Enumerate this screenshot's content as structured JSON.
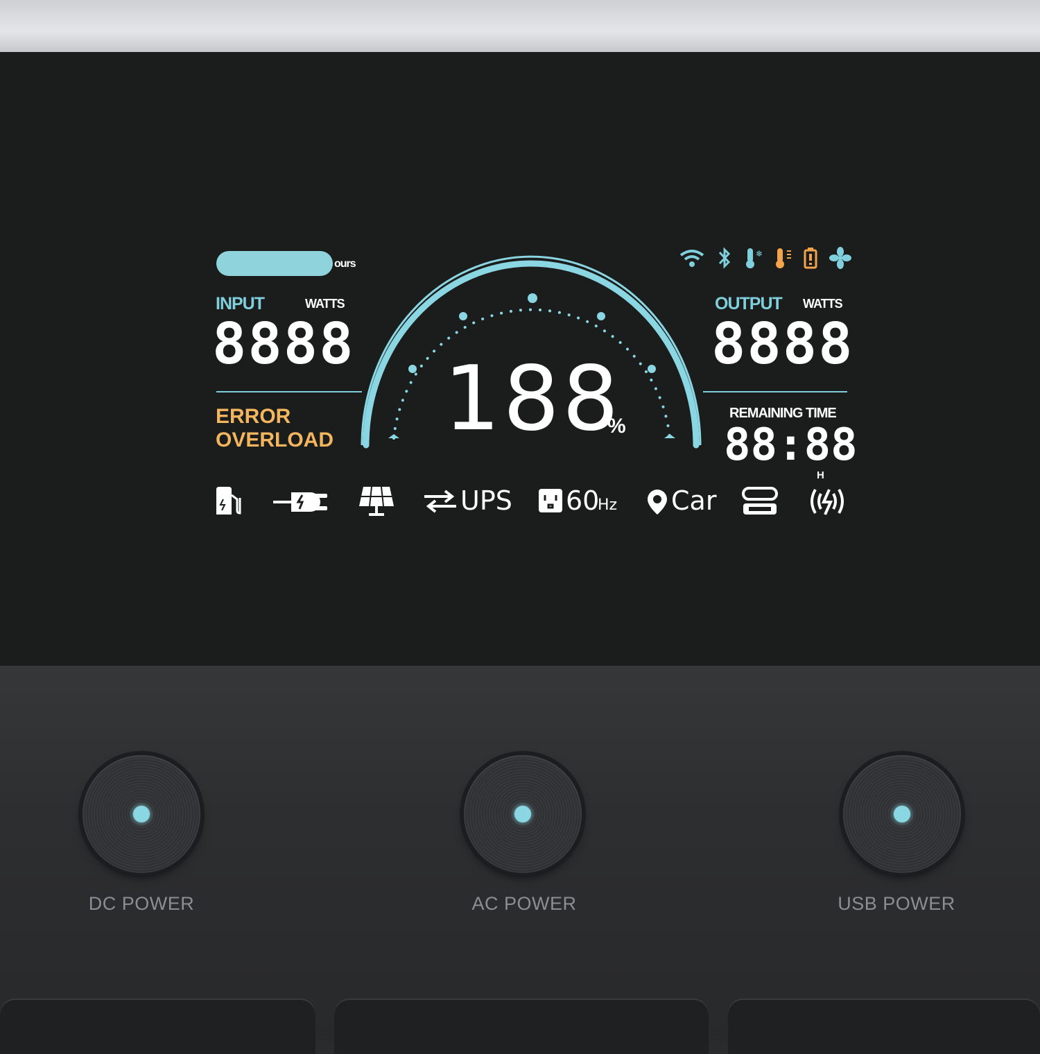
{
  "header": {
    "pill_label": "ours"
  },
  "input": {
    "title": "INPUT",
    "unit": "WATTS",
    "value": "8888"
  },
  "output": {
    "title": "OUTPUT",
    "unit": "WATTS",
    "value": "8888"
  },
  "gauge": {
    "percent_value": "188",
    "percent_symbol": "%"
  },
  "status": {
    "error": "ERROR",
    "overload": "OVERLOAD"
  },
  "remaining": {
    "title": "REMAINING TIME",
    "value": "88:88",
    "unit": "H"
  },
  "modes": {
    "ups": "UPS",
    "hz_value": "60",
    "hz_unit": "Hz",
    "car": "Car"
  },
  "buttons": [
    {
      "label": "DC POWER"
    },
    {
      "label": "AC POWER"
    },
    {
      "label": "USB POWER"
    }
  ],
  "colors": {
    "accent": "#7fd0dc",
    "warning": "#f3b55d",
    "screen": "#1b1c1c",
    "panel": "#2e2f31"
  },
  "icons": [
    "wifi-icon",
    "bluetooth-icon",
    "low-temp-icon",
    "high-temp-icon",
    "battery-warning-icon",
    "fan-icon",
    "fuel-pump-icon",
    "plug-icon",
    "solar-panel-icon",
    "ac-outlet-icon",
    "location-pin-icon",
    "usb-c-icon",
    "wireless-charging-icon"
  ]
}
